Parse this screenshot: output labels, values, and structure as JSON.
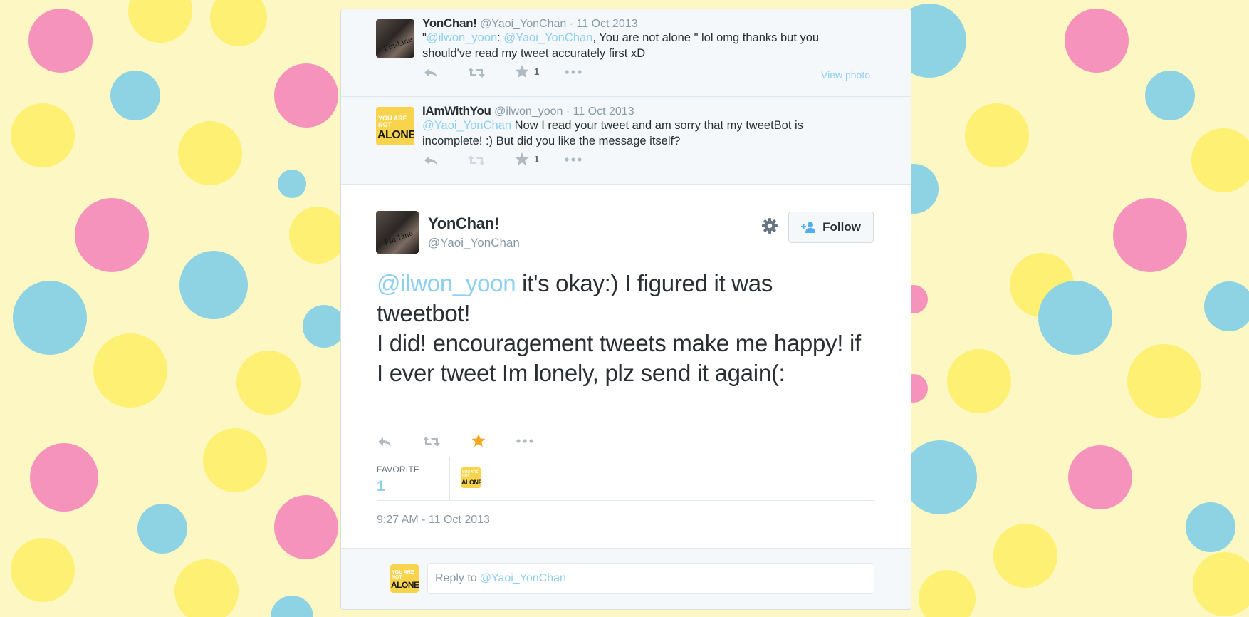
{
  "colors": {
    "background": "#fdf7c3",
    "dot_pink": "#f693bd",
    "dot_blue": "#8dd3e3",
    "dot_yellow": "#fdf073",
    "mention": "#8ecfef",
    "favorited_star": "#f5a623"
  },
  "context_tweets": [
    {
      "name": "YonChan!",
      "handle": "@Yaoi_YonChan",
      "date": "· 11 Oct 2013",
      "text_prefix": "\"",
      "mention1": "@ilwon_yoon",
      "sep1": ": ",
      "mention2": "@Yaoi_YonChan",
      "text_rest": ", You are not alone \" lol omg thanks but you should've read my tweet accurately first xD",
      "favorite_count": "1",
      "view_photo": "View photo",
      "avatar": "photo-avatar",
      "avatar_text": "Fin-Line"
    },
    {
      "name": "IAmWithYou",
      "handle": "@ilwon_yoon",
      "date": "· 11 Oct 2013",
      "mention1": "@Yaoi_YonChan",
      "text_rest": " Now I read your tweet and am sorry that my tweetBot is incomplete! :) But did you like the message itself?",
      "favorite_count": "1",
      "avatar": "you-are-not-alone-avatar",
      "avatar_small": "YOU ARE NOT",
      "avatar_big": "ALONE"
    }
  ],
  "main_tweet": {
    "name": "YonChan!",
    "handle": "@Yaoi_YonChan",
    "follow_label": "Follow",
    "mention": "@ilwon_yoon",
    "line1": " it's okay:) I figured it was tweetbot!",
    "line2": "I did! encouragement tweets make me happy! if I ever tweet Im lonely, plz send it again(:",
    "favorite_label": "FAVORITE",
    "favorite_count": "1",
    "timestamp": "9:27 AM - 11 Oct 2013",
    "avatar_text": "Fin-Line",
    "favoriter_small": "YOU ARE NOT",
    "favoriter_big": "ALONE"
  },
  "reply": {
    "prefix": "Reply to",
    "mention": "@Yaoi_YonChan",
    "avatar_small": "YOU ARE NOT",
    "avatar_big": "ALONE"
  },
  "icons": [
    "reply-icon",
    "retweet-icon",
    "favorite-star-icon",
    "more-dots-icon",
    "gear-icon",
    "follow-person-plus-icon"
  ]
}
